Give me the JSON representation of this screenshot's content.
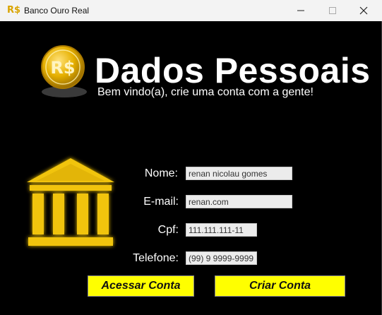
{
  "window": {
    "title": "Banco Ouro Real",
    "app_icon_text": "R$"
  },
  "titlebar": {
    "minimize_icon": "minimize-icon",
    "maximize_icon": "maximize-icon",
    "close_icon": "close-icon"
  },
  "header": {
    "coin_text": "R$",
    "title": "Dados Pessoais",
    "subtitle": "Bem vindo(a), crie uma conta com a gente!"
  },
  "form": {
    "name_label": "Nome:",
    "name_value": "renan nicolau gomes",
    "email_label": "E-mail:",
    "email_value": "renan.com",
    "cpf_label": "Cpf:",
    "cpf_value": "111.111.111-11",
    "phone_label": "Telefone:",
    "phone_value": "(99) 9 9999-9999"
  },
  "buttons": {
    "access": "Acessar Conta",
    "create": "Criar Conta"
  },
  "colors": {
    "accent": "#ffff00",
    "coin_gold": "#e6b000",
    "background": "#000000"
  }
}
